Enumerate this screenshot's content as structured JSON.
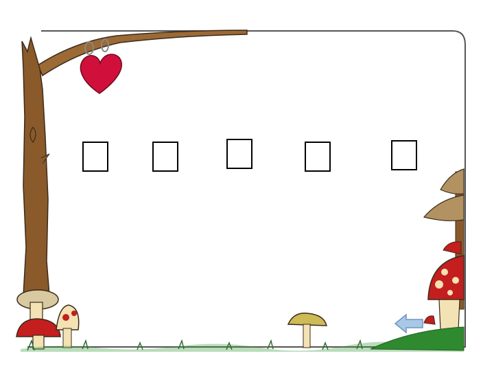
{
  "slide": {
    "placeholder_glyphs": [
      "□",
      "□",
      "□",
      "□",
      "□"
    ]
  },
  "navigation": {
    "back_icon": "left-arrow-icon"
  },
  "colors": {
    "frame_border": "#555555",
    "tree_trunk": "#8a5a2b",
    "heart": "#d0103a",
    "mushroom_red": "#c41e1e",
    "mushroom_stem": "#f3e2b3",
    "grass": "#2f8a2f",
    "arrow": "#a8c8e8"
  }
}
